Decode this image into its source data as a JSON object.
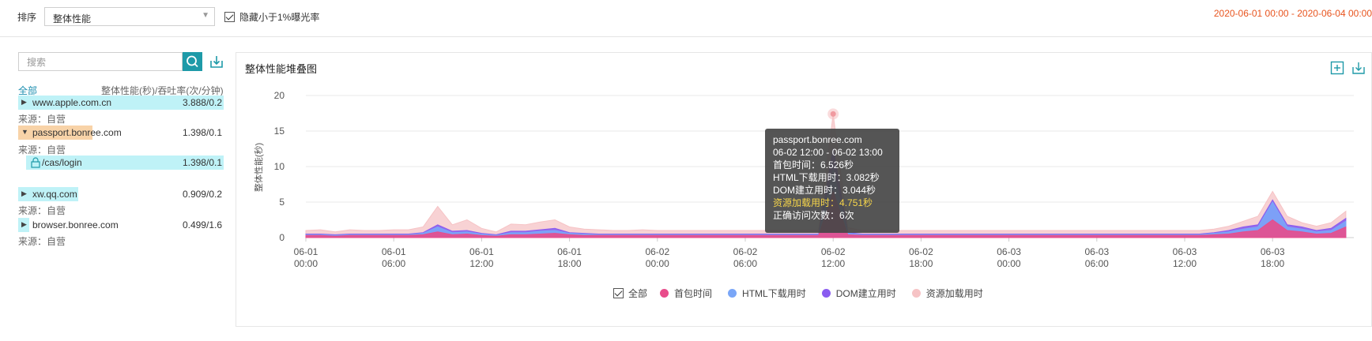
{
  "toolbar": {
    "sort_label": "排序",
    "sort_value": "整体性能",
    "hide_low_label": "隐藏小于1%曝光率",
    "hide_low_checked": true,
    "date_range": "2020-06-01 00:00 - 2020-06-04 00:00"
  },
  "sidebar": {
    "search_placeholder": "搜索",
    "all_label": "全部",
    "metric_header": "整体性能(秒)/吞吐率(次/分钟)",
    "items": [
      {
        "name": "www.apple.com.cn",
        "value": "3.888/0.2",
        "source": "来源：自营"
      },
      {
        "name": "passport.bonree.com",
        "value": "1.398/0.1",
        "source": "来源：自营"
      },
      {
        "name": "/cas/login",
        "value": "1.398/0.1"
      },
      {
        "name": "xw.qq.com",
        "value": "0.909/0.2",
        "source": "来源：自营"
      },
      {
        "name": "browser.bonree.com",
        "value": "0.499/1.6",
        "source": "来源：自营"
      }
    ]
  },
  "chart_panel": {
    "title": "整体性能堆叠图",
    "tooltip": {
      "host": "passport.bonree.com",
      "range": "06-02 12:00 - 06-02 13:00",
      "lines": [
        {
          "label": "首包时间：",
          "value": "6.526秒"
        },
        {
          "label": "HTML下载用时：",
          "value": "3.082秒"
        },
        {
          "label": "DOM建立用时：",
          "value": "3.044秒"
        },
        {
          "label": "资源加载用时：",
          "value": "4.751秒",
          "highlight": true
        },
        {
          "label": "正确访问次数：",
          "value": "6次"
        }
      ]
    },
    "legend_all": "全部"
  },
  "chart_data": {
    "type": "area",
    "stacked": true,
    "ylabel": "整体性能(秒)",
    "ylim": [
      0,
      20
    ],
    "yticks": [
      0,
      5,
      10,
      15,
      20
    ],
    "xticks": [
      [
        "06-01",
        "00:00"
      ],
      [
        "06-01",
        "06:00"
      ],
      [
        "06-01",
        "12:00"
      ],
      [
        "06-01",
        "18:00"
      ],
      [
        "06-02",
        "00:00"
      ],
      [
        "06-02",
        "06:00"
      ],
      [
        "06-02",
        "12:00"
      ],
      [
        "06-02",
        "18:00"
      ],
      [
        "06-03",
        "00:00"
      ],
      [
        "06-03",
        "06:00"
      ],
      [
        "06-03",
        "12:00"
      ],
      [
        "06-03",
        "18:00"
      ]
    ],
    "x_hours": [
      0,
      1,
      2,
      3,
      4,
      5,
      6,
      7,
      8,
      9,
      10,
      11,
      12,
      13,
      14,
      15,
      16,
      17,
      18,
      19,
      20,
      21,
      22,
      23,
      24,
      25,
      26,
      27,
      28,
      29,
      30,
      31,
      32,
      33,
      34,
      35,
      36,
      37,
      38,
      39,
      40,
      41,
      42,
      43,
      44,
      45,
      46,
      47,
      48,
      49,
      50,
      51,
      52,
      53,
      54,
      55,
      56,
      57,
      58,
      59,
      60,
      61,
      62,
      63,
      64,
      65,
      66,
      67,
      68,
      69,
      70,
      71
    ],
    "series": [
      {
        "name": "首包时间",
        "color": "#e84c8b",
        "values": [
          0.3,
          0.3,
          0.2,
          0.3,
          0.3,
          0.3,
          0.3,
          0.3,
          0.4,
          0.8,
          0.4,
          0.5,
          0.3,
          0.2,
          0.4,
          0.4,
          0.5,
          0.6,
          0.4,
          0.3,
          0.3,
          0.3,
          0.3,
          0.3,
          0.3,
          0.3,
          0.3,
          0.3,
          0.3,
          0.3,
          0.3,
          0.3,
          0.3,
          0.3,
          0.3,
          0.3,
          6.5,
          0.4,
          0.3,
          0.3,
          0.3,
          0.3,
          0.3,
          0.3,
          0.3,
          0.3,
          0.3,
          0.3,
          0.3,
          0.3,
          0.3,
          0.3,
          0.3,
          0.3,
          0.3,
          0.3,
          0.3,
          0.3,
          0.3,
          0.3,
          0.3,
          0.3,
          0.4,
          0.5,
          0.8,
          1.0,
          2.5,
          1.0,
          0.8,
          0.5,
          0.6,
          1.5
        ]
      },
      {
        "name": "HTML下载用时",
        "color": "#7aa6f7",
        "values": [
          0.1,
          0.1,
          0.1,
          0.1,
          0.1,
          0.1,
          0.1,
          0.1,
          0.2,
          0.7,
          0.3,
          0.3,
          0.2,
          0.1,
          0.3,
          0.3,
          0.4,
          0.4,
          0.2,
          0.2,
          0.1,
          0.1,
          0.1,
          0.1,
          0.1,
          0.1,
          0.1,
          0.1,
          0.1,
          0.1,
          0.1,
          0.1,
          0.1,
          0.1,
          0.1,
          0.1,
          3.1,
          0.2,
          0.1,
          0.1,
          0.1,
          0.1,
          0.1,
          0.1,
          0.1,
          0.1,
          0.1,
          0.1,
          0.1,
          0.1,
          0.1,
          0.1,
          0.1,
          0.1,
          0.1,
          0.1,
          0.1,
          0.1,
          0.1,
          0.1,
          0.1,
          0.1,
          0.2,
          0.3,
          0.4,
          0.5,
          2.5,
          0.5,
          0.4,
          0.3,
          0.4,
          0.8
        ]
      },
      {
        "name": "DOM建立用时",
        "color": "#8a5cf0",
        "values": [
          0.1,
          0.1,
          0.1,
          0.1,
          0.1,
          0.1,
          0.1,
          0.1,
          0.1,
          0.3,
          0.2,
          0.2,
          0.1,
          0.1,
          0.2,
          0.2,
          0.2,
          0.3,
          0.1,
          0.1,
          0.1,
          0.1,
          0.1,
          0.1,
          0.1,
          0.1,
          0.1,
          0.1,
          0.1,
          0.1,
          0.1,
          0.1,
          0.1,
          0.1,
          0.1,
          0.1,
          3.0,
          0.1,
          0.1,
          0.1,
          0.1,
          0.1,
          0.1,
          0.1,
          0.1,
          0.1,
          0.1,
          0.1,
          0.1,
          0.1,
          0.1,
          0.1,
          0.1,
          0.1,
          0.1,
          0.1,
          0.1,
          0.1,
          0.1,
          0.1,
          0.1,
          0.1,
          0.1,
          0.2,
          0.3,
          0.3,
          0.3,
          0.3,
          0.3,
          0.2,
          0.3,
          0.4
        ]
      },
      {
        "name": "资源加载用时",
        "color": "#f6c3c5",
        "values": [
          0.5,
          0.6,
          0.4,
          0.6,
          0.5,
          0.5,
          0.6,
          0.6,
          0.8,
          2.6,
          0.9,
          1.5,
          0.7,
          0.4,
          1.0,
          0.9,
          1.1,
          1.2,
          0.8,
          0.6,
          0.6,
          0.5,
          0.5,
          0.6,
          0.5,
          0.5,
          0.5,
          0.5,
          0.5,
          0.5,
          0.5,
          0.5,
          0.5,
          0.5,
          0.5,
          0.5,
          4.8,
          0.7,
          0.5,
          0.5,
          0.5,
          0.5,
          0.5,
          0.5,
          0.5,
          0.5,
          0.5,
          0.5,
          0.5,
          0.5,
          0.5,
          0.5,
          0.5,
          0.5,
          0.5,
          0.5,
          0.5,
          0.5,
          0.5,
          0.5,
          0.5,
          0.5,
          0.5,
          0.6,
          0.8,
          1.2,
          1.2,
          1.2,
          0.6,
          0.6,
          0.8,
          1.0
        ]
      }
    ],
    "grid": true,
    "legend_position": "bottom"
  }
}
